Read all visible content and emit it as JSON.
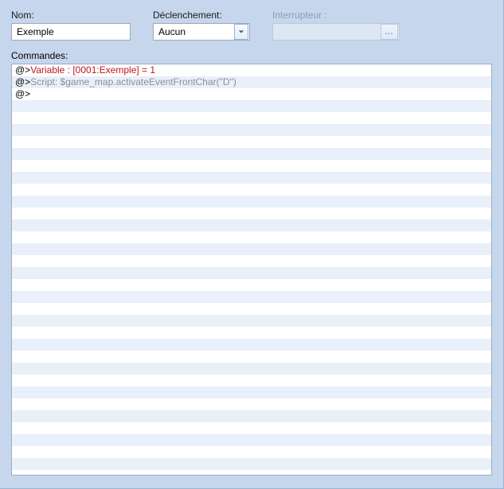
{
  "fields": {
    "name_label": "Nom:",
    "name_value": "Exemple",
    "trigger_label": "Déclenchement:",
    "trigger_value": "Aucun",
    "switch_label": "Interrupteur :",
    "switch_value": "",
    "switch_button": "..."
  },
  "commands": {
    "label": "Commandes:",
    "prefix": "@>",
    "lines": [
      {
        "text": "Variable : [0001:Exemple] = 1",
        "color": "red"
      },
      {
        "text": "Script: $game_map.activateEventFrontChar(\"D\")",
        "color": "gray"
      },
      {
        "text": "",
        "color": "black"
      }
    ],
    "blank_rows": 31
  }
}
